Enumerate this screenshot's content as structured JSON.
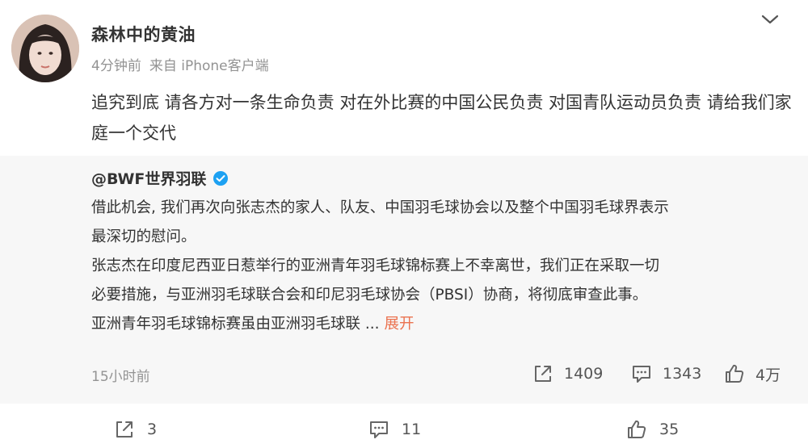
{
  "post": {
    "username": "森林中的黄油",
    "time": "4分钟前",
    "source": "来自 iPhone客户端",
    "content": "追究到底 请各方对一条生命负责 对在外比赛的中国公民负责 对国青队运动员负责 请给我们家庭一个交代"
  },
  "repost": {
    "username": "@BWF世界羽联",
    "text_lines": [
      "借此机会, 我们再次向张志杰的家人、队友、中国羽毛球协会以及整个中国羽毛球界表示",
      "最深切的慰问。",
      "张志杰在印度尼西亚日惹举行的亚洲青年羽毛球锦标赛上不幸离世，我们正在采取一切",
      "必要措施，与亚洲羽毛球联合会和印尼羽毛球协会（PBSI）协商，将彻底审查此事。",
      "亚洲青年羽毛球锦标赛虽由亚洲羽毛球联 ..."
    ],
    "expand_label": "展开",
    "time": "15小时前",
    "reposts": "1409",
    "comments": "1343",
    "likes": "4万"
  },
  "actions": {
    "reposts": "3",
    "comments": "11",
    "likes": "35"
  },
  "icons": [
    "chevron-down-icon",
    "verified-badge-icon",
    "repost-icon",
    "comment-icon",
    "like-icon"
  ],
  "colors": {
    "accent": "#eb7350",
    "verified": "#1da1f2",
    "muted": "#939393",
    "repost_bg": "#f7f7f7"
  }
}
